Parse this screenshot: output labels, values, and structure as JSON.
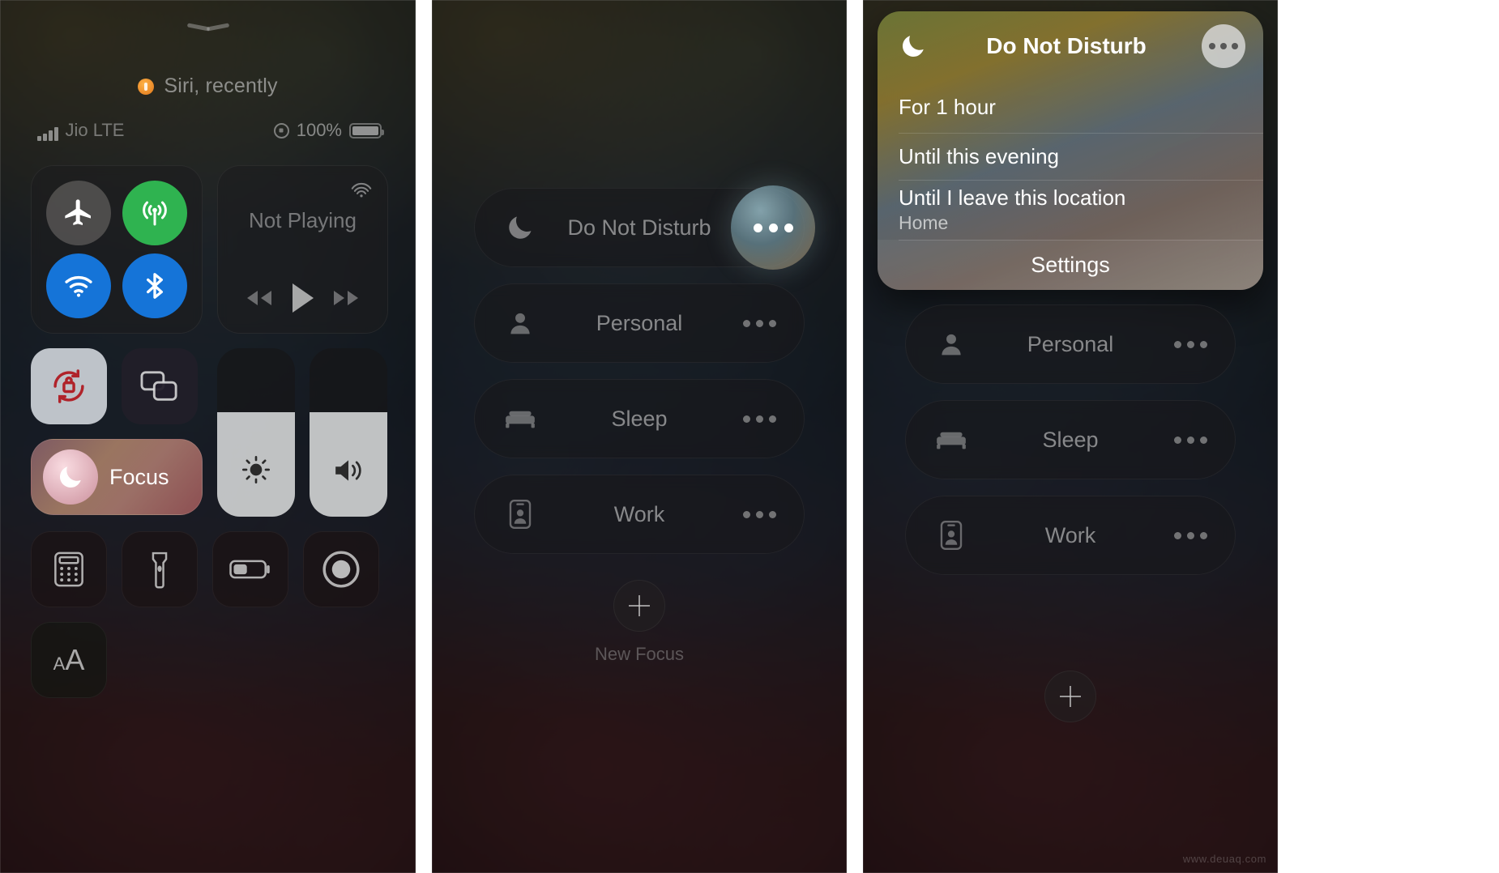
{
  "panel1": {
    "siri_suggestion": "Siri, recently",
    "status": {
      "carrier": "Jio LTE",
      "battery_percent": "100%"
    },
    "media": {
      "title": "Not Playing"
    },
    "focus_tile": {
      "label": "Focus"
    },
    "icons": {
      "grabber": "chevron-down-grabber-icon",
      "siri": "siri-icon",
      "signal": "cellular-signal-icon",
      "orientation_lock": "orientation-lock-icon",
      "battery": "battery-icon",
      "airplane": "airplane-mode-icon",
      "cellular": "cellular-data-icon",
      "wifi": "wifi-icon",
      "bluetooth": "bluetooth-icon",
      "airplay": "airplay-icon",
      "rewind": "rewind-icon",
      "play": "play-icon",
      "forward": "fast-forward-icon",
      "rotation_lock": "rotation-lock-icon",
      "screen_mirror": "screen-mirroring-icon",
      "moon": "moon-icon",
      "brightness": "brightness-icon",
      "volume": "volume-icon",
      "calculator": "calculator-icon",
      "flashlight": "flashlight-icon",
      "low_power": "low-power-mode-icon",
      "screen_record": "screen-record-icon",
      "text_size_small": "A",
      "text_size_large": "A"
    }
  },
  "panel2": {
    "focus_items": [
      {
        "label": "Do Not Disturb",
        "icon": "moon-icon",
        "highlighted": true
      },
      {
        "label": "Personal",
        "icon": "person-icon",
        "highlighted": false
      },
      {
        "label": "Sleep",
        "icon": "bed-icon",
        "highlighted": false
      },
      {
        "label": "Work",
        "icon": "badge-icon",
        "highlighted": false
      }
    ],
    "new_focus": {
      "label": "New Focus",
      "icon": "plus-icon"
    }
  },
  "panel3": {
    "menu": {
      "title": "Do Not Disturb",
      "header_icon": "moon-icon",
      "more_icon": "ellipsis-icon",
      "options": [
        {
          "title": "For 1 hour",
          "subtitle": ""
        },
        {
          "title": "Until this evening",
          "subtitle": ""
        },
        {
          "title": "Until I leave this location",
          "subtitle": "Home"
        }
      ],
      "settings_label": "Settings"
    },
    "focus_items": [
      {
        "label": "Personal",
        "icon": "person-icon"
      },
      {
        "label": "Sleep",
        "icon": "bed-icon"
      },
      {
        "label": "Work",
        "icon": "badge-icon"
      }
    ],
    "new_focus": {
      "icon": "plus-icon"
    }
  },
  "watermark": "www.deuaq.com"
}
